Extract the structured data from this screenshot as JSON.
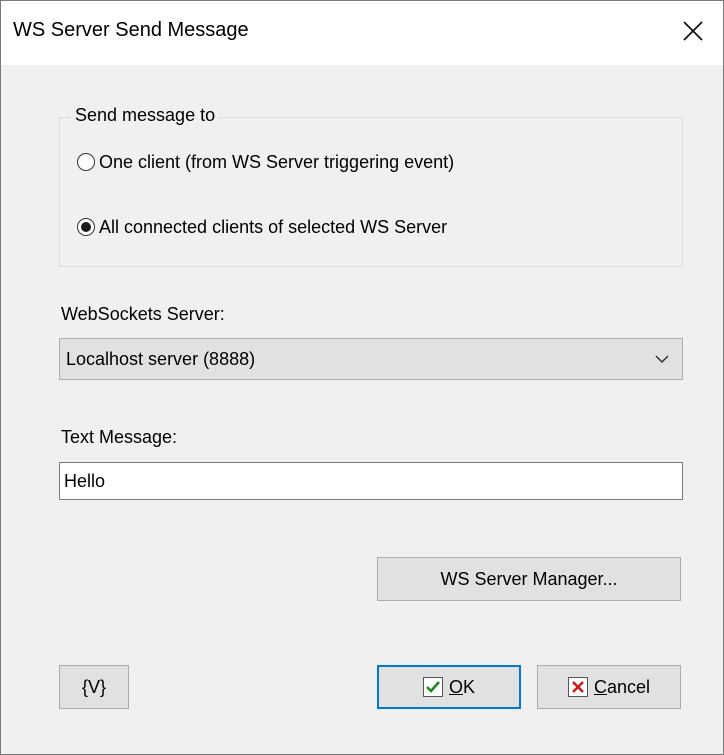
{
  "window": {
    "title": "WS Server Send Message",
    "close_label": "✕"
  },
  "send_group": {
    "legend": "Send message to",
    "options": [
      {
        "label": "One client (from WS Server triggering event)",
        "checked": false
      },
      {
        "label": "All connected clients of selected WS Server",
        "checked": true
      }
    ]
  },
  "server": {
    "label": "WebSockets Server:",
    "selected": "Localhost server (8888)"
  },
  "message": {
    "label": "Text Message:",
    "value": "Hello"
  },
  "buttons": {
    "manager": "WS Server Manager...",
    "variables": "{V}",
    "ok_accel": "O",
    "ok_rest": "K",
    "cancel_accel": "C",
    "cancel_rest": "ancel"
  },
  "colors": {
    "ok_check": "#1e8a1e",
    "cancel_x": "#d01818",
    "default_border": "#0078d7"
  }
}
